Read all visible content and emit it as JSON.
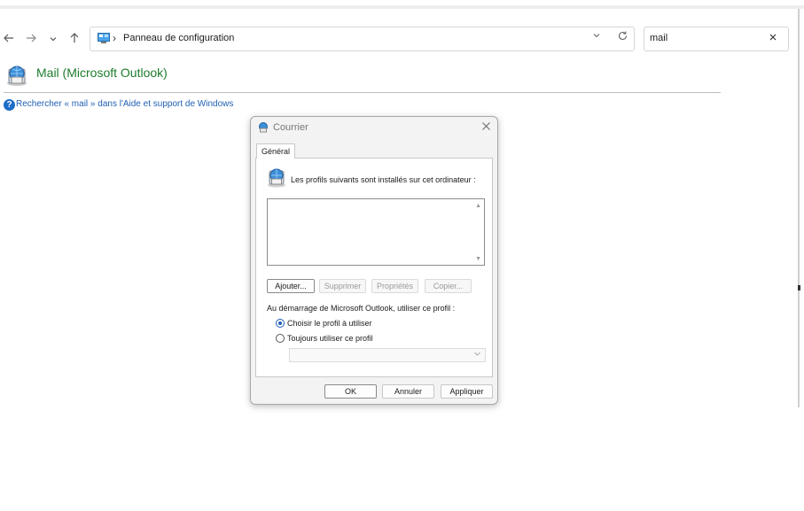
{
  "explorer": {
    "nav": {
      "back_icon": "arrow-left-icon",
      "forward_icon": "arrow-right-icon",
      "recent_icon": "chevron-down-icon",
      "up_icon": "arrow-up-icon"
    },
    "address": {
      "separator": "›",
      "path": "Panneau de configuration"
    },
    "search": {
      "value": "mail"
    }
  },
  "content": {
    "title": "Mail (Microsoft Outlook)",
    "help_link": "Rechercher « mail » dans l'Aide et support de Windows"
  },
  "dialog": {
    "title": "Courrier",
    "tab": "Général",
    "profiles_text": "Les profils suivants sont installés sur cet ordinateur :",
    "buttons": {
      "add": "Ajouter...",
      "remove": "Supprimer",
      "properties": "Propriétés",
      "copy": "Copier..."
    },
    "startup_label": "Au démarrage de Microsoft Outlook, utiliser ce profil :",
    "options": {
      "prompt": "Choisir le profil à utiliser",
      "always": "Toujours utiliser ce profil"
    },
    "selected_option": "prompt",
    "footer": {
      "ok": "OK",
      "cancel": "Annuler",
      "apply": "Appliquer"
    }
  },
  "colors": {
    "title_green": "#1e7c2c",
    "link_blue": "#1e5fb4",
    "accent": "#1e6dc8"
  }
}
